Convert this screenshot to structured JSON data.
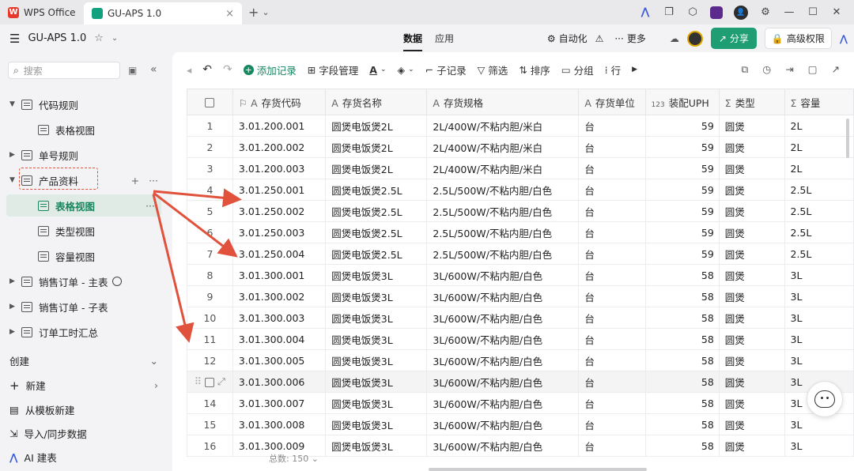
{
  "titlebar": {
    "tabs": [
      {
        "label": "WPS Office",
        "icon": "wps-logo-icon"
      },
      {
        "label": "GU-APS 1.0",
        "icon": "app-logo-icon"
      }
    ],
    "close_glyph": "×",
    "plus_glyph": "+",
    "dropdown_glyph": "⌄",
    "avatar_text": "👤"
  },
  "appbar": {
    "title": "GU-APS 1.0",
    "tabs": [
      "数据",
      "应用"
    ],
    "automation": "自动化",
    "more": "更多",
    "share": "分享",
    "permission": "高级权限"
  },
  "sidebar": {
    "search_placeholder": "搜索",
    "tree": [
      {
        "label": "代码规则",
        "type": "parent"
      },
      {
        "label": "表格视图",
        "type": "child"
      },
      {
        "label": "单号规则",
        "type": "parent"
      },
      {
        "label": "产品资料",
        "type": "parent"
      },
      {
        "label": "表格视图",
        "type": "child-selected"
      },
      {
        "label": "类型视图",
        "type": "child"
      },
      {
        "label": "容量视图",
        "type": "child"
      },
      {
        "label": "销售订单 - 主表",
        "type": "parent"
      },
      {
        "label": "销售订单 - 子表",
        "type": "parent"
      },
      {
        "label": "订单工时汇总",
        "type": "parent"
      }
    ],
    "create_section": "创建",
    "create_items": [
      {
        "label": "新建",
        "icon": "plus-icon"
      },
      {
        "label": "从模板新建",
        "icon": "template-icon"
      },
      {
        "label": "导入/同步数据",
        "icon": "import-icon"
      },
      {
        "label": "AI 建表",
        "icon": "ai-icon"
      }
    ]
  },
  "toolbar": {
    "add_record": "添加记录",
    "field_manage": "字段管理",
    "sub_record": "子记录",
    "filter": "筛选",
    "sort": "排序",
    "group": "分组",
    "row": "行"
  },
  "table": {
    "columns": [
      "存货代码",
      "存货名称",
      "存货规格",
      "存货单位",
      "装配UPH",
      "类型",
      "容量"
    ],
    "column_icons": [
      "A",
      "A",
      "A",
      "A",
      "123",
      "Σ",
      "Σ"
    ],
    "rows": [
      {
        "idx": "1",
        "code": "3.01.200.001",
        "name": "圆煲电饭煲2L",
        "spec": "2L/400W/不粘内胆/米白",
        "unit": "台",
        "uph": "59",
        "type": "圆煲",
        "cap": "2L"
      },
      {
        "idx": "2",
        "code": "3.01.200.002",
        "name": "圆煲电饭煲2L",
        "spec": "2L/400W/不粘内胆/米白",
        "unit": "台",
        "uph": "59",
        "type": "圆煲",
        "cap": "2L"
      },
      {
        "idx": "3",
        "code": "3.01.200.003",
        "name": "圆煲电饭煲2L",
        "spec": "2L/400W/不粘内胆/米白",
        "unit": "台",
        "uph": "59",
        "type": "圆煲",
        "cap": "2L"
      },
      {
        "idx": "4",
        "code": "3.01.250.001",
        "name": "圆煲电饭煲2.5L",
        "spec": "2.5L/500W/不粘内胆/白色",
        "unit": "台",
        "uph": "59",
        "type": "圆煲",
        "cap": "2.5L"
      },
      {
        "idx": "5",
        "code": "3.01.250.002",
        "name": "圆煲电饭煲2.5L",
        "spec": "2.5L/500W/不粘内胆/白色",
        "unit": "台",
        "uph": "59",
        "type": "圆煲",
        "cap": "2.5L"
      },
      {
        "idx": "6",
        "code": "3.01.250.003",
        "name": "圆煲电饭煲2.5L",
        "spec": "2.5L/500W/不粘内胆/白色",
        "unit": "台",
        "uph": "59",
        "type": "圆煲",
        "cap": "2.5L"
      },
      {
        "idx": "7",
        "code": "3.01.250.004",
        "name": "圆煲电饭煲2.5L",
        "spec": "2.5L/500W/不粘内胆/白色",
        "unit": "台",
        "uph": "59",
        "type": "圆煲",
        "cap": "2.5L"
      },
      {
        "idx": "8",
        "code": "3.01.300.001",
        "name": "圆煲电饭煲3L",
        "spec": "3L/600W/不粘内胆/白色",
        "unit": "台",
        "uph": "58",
        "type": "圆煲",
        "cap": "3L"
      },
      {
        "idx": "9",
        "code": "3.01.300.002",
        "name": "圆煲电饭煲3L",
        "spec": "3L/600W/不粘内胆/白色",
        "unit": "台",
        "uph": "58",
        "type": "圆煲",
        "cap": "3L"
      },
      {
        "idx": "10",
        "code": "3.01.300.003",
        "name": "圆煲电饭煲3L",
        "spec": "3L/600W/不粘内胆/白色",
        "unit": "台",
        "uph": "58",
        "type": "圆煲",
        "cap": "3L"
      },
      {
        "idx": "11",
        "code": "3.01.300.004",
        "name": "圆煲电饭煲3L",
        "spec": "3L/600W/不粘内胆/白色",
        "unit": "台",
        "uph": "58",
        "type": "圆煲",
        "cap": "3L"
      },
      {
        "idx": "12",
        "code": "3.01.300.005",
        "name": "圆煲电饭煲3L",
        "spec": "3L/600W/不粘内胆/白色",
        "unit": "台",
        "uph": "58",
        "type": "圆煲",
        "cap": "3L"
      },
      {
        "idx": "",
        "code": "3.01.300.006",
        "name": "圆煲电饭煲3L",
        "spec": "3L/600W/不粘内胆/白色",
        "unit": "台",
        "uph": "58",
        "type": "圆煲",
        "cap": "3L"
      },
      {
        "idx": "14",
        "code": "3.01.300.007",
        "name": "圆煲电饭煲3L",
        "spec": "3L/600W/不粘内胆/白色",
        "unit": "台",
        "uph": "58",
        "type": "圆煲",
        "cap": "3L"
      },
      {
        "idx": "15",
        "code": "3.01.300.008",
        "name": "圆煲电饭煲3L",
        "spec": "3L/600W/不粘内胆/白色",
        "unit": "台",
        "uph": "58",
        "type": "圆煲",
        "cap": "3L"
      },
      {
        "idx": "16",
        "code": "3.01.300.009",
        "name": "圆煲电饭煲3L",
        "spec": "3L/600W/不粘内胆/白色",
        "unit": "台",
        "uph": "58",
        "type": "圆煲",
        "cap": "3L"
      }
    ],
    "hover_row_index": 12,
    "footer_label": "总数",
    "footer_count": "150"
  },
  "colors": {
    "accent": "#16875f",
    "annotation": "#e0523c"
  }
}
